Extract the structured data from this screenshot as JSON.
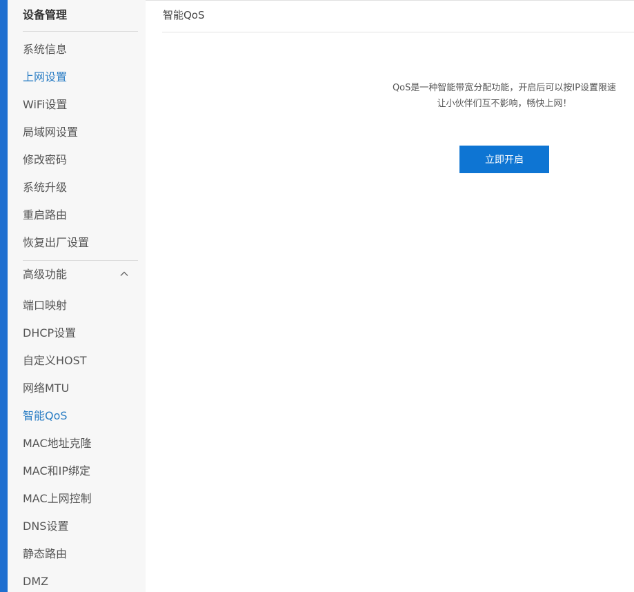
{
  "sidebar": {
    "title": "设备管理",
    "items": [
      {
        "label": "系统信息",
        "active": false
      },
      {
        "label": "上网设置",
        "active": true
      },
      {
        "label": "WiFi设置",
        "active": false
      },
      {
        "label": "局域网设置",
        "active": false
      },
      {
        "label": "修改密码",
        "active": false
      },
      {
        "label": "系统升级",
        "active": false
      },
      {
        "label": "重启路由",
        "active": false
      },
      {
        "label": "恢复出厂设置",
        "active": false
      }
    ],
    "advanced": {
      "label": "高级功能",
      "expanded": true,
      "icon": "chevron-up-icon",
      "items": [
        {
          "label": "端口映射",
          "active": false
        },
        {
          "label": "DHCP设置",
          "active": false
        },
        {
          "label": "自定义HOST",
          "active": false
        },
        {
          "label": "网络MTU",
          "active": false
        },
        {
          "label": "智能QoS",
          "active": true
        },
        {
          "label": "MAC地址克隆",
          "active": false
        },
        {
          "label": "MAC和IP绑定",
          "active": false
        },
        {
          "label": "MAC上网控制",
          "active": false
        },
        {
          "label": "DNS设置",
          "active": false
        },
        {
          "label": "静态路由",
          "active": false
        },
        {
          "label": "DMZ",
          "active": false
        }
      ]
    }
  },
  "main": {
    "title": "智能QoS",
    "description_line1": "QoS是一种智能带宽分配功能，开启后可以按IP设置限速",
    "description_line2": "让小伙伴们互不影响，畅快上网！",
    "enable_button_label": "立即开启"
  },
  "colors": {
    "accent": "#1f6fd0",
    "active_link": "#2a7dc4",
    "button": "#0e75d3"
  }
}
